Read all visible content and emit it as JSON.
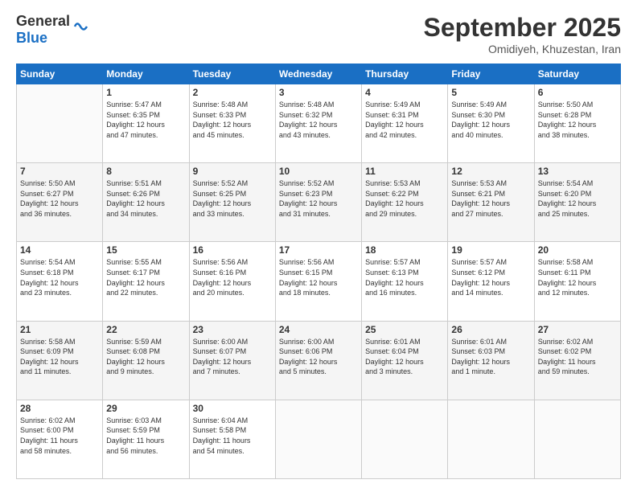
{
  "header": {
    "logo_line1": "General",
    "logo_line2": "Blue",
    "month": "September 2025",
    "location": "Omidiyeh, Khuzestan, Iran"
  },
  "days_of_week": [
    "Sunday",
    "Monday",
    "Tuesday",
    "Wednesday",
    "Thursday",
    "Friday",
    "Saturday"
  ],
  "weeks": [
    [
      {
        "day": "",
        "info": ""
      },
      {
        "day": "1",
        "info": "Sunrise: 5:47 AM\nSunset: 6:35 PM\nDaylight: 12 hours\nand 47 minutes."
      },
      {
        "day": "2",
        "info": "Sunrise: 5:48 AM\nSunset: 6:33 PM\nDaylight: 12 hours\nand 45 minutes."
      },
      {
        "day": "3",
        "info": "Sunrise: 5:48 AM\nSunset: 6:32 PM\nDaylight: 12 hours\nand 43 minutes."
      },
      {
        "day": "4",
        "info": "Sunrise: 5:49 AM\nSunset: 6:31 PM\nDaylight: 12 hours\nand 42 minutes."
      },
      {
        "day": "5",
        "info": "Sunrise: 5:49 AM\nSunset: 6:30 PM\nDaylight: 12 hours\nand 40 minutes."
      },
      {
        "day": "6",
        "info": "Sunrise: 5:50 AM\nSunset: 6:28 PM\nDaylight: 12 hours\nand 38 minutes."
      }
    ],
    [
      {
        "day": "7",
        "info": "Sunrise: 5:50 AM\nSunset: 6:27 PM\nDaylight: 12 hours\nand 36 minutes."
      },
      {
        "day": "8",
        "info": "Sunrise: 5:51 AM\nSunset: 6:26 PM\nDaylight: 12 hours\nand 34 minutes."
      },
      {
        "day": "9",
        "info": "Sunrise: 5:52 AM\nSunset: 6:25 PM\nDaylight: 12 hours\nand 33 minutes."
      },
      {
        "day": "10",
        "info": "Sunrise: 5:52 AM\nSunset: 6:23 PM\nDaylight: 12 hours\nand 31 minutes."
      },
      {
        "day": "11",
        "info": "Sunrise: 5:53 AM\nSunset: 6:22 PM\nDaylight: 12 hours\nand 29 minutes."
      },
      {
        "day": "12",
        "info": "Sunrise: 5:53 AM\nSunset: 6:21 PM\nDaylight: 12 hours\nand 27 minutes."
      },
      {
        "day": "13",
        "info": "Sunrise: 5:54 AM\nSunset: 6:20 PM\nDaylight: 12 hours\nand 25 minutes."
      }
    ],
    [
      {
        "day": "14",
        "info": "Sunrise: 5:54 AM\nSunset: 6:18 PM\nDaylight: 12 hours\nand 23 minutes."
      },
      {
        "day": "15",
        "info": "Sunrise: 5:55 AM\nSunset: 6:17 PM\nDaylight: 12 hours\nand 22 minutes."
      },
      {
        "day": "16",
        "info": "Sunrise: 5:56 AM\nSunset: 6:16 PM\nDaylight: 12 hours\nand 20 minutes."
      },
      {
        "day": "17",
        "info": "Sunrise: 5:56 AM\nSunset: 6:15 PM\nDaylight: 12 hours\nand 18 minutes."
      },
      {
        "day": "18",
        "info": "Sunrise: 5:57 AM\nSunset: 6:13 PM\nDaylight: 12 hours\nand 16 minutes."
      },
      {
        "day": "19",
        "info": "Sunrise: 5:57 AM\nSunset: 6:12 PM\nDaylight: 12 hours\nand 14 minutes."
      },
      {
        "day": "20",
        "info": "Sunrise: 5:58 AM\nSunset: 6:11 PM\nDaylight: 12 hours\nand 12 minutes."
      }
    ],
    [
      {
        "day": "21",
        "info": "Sunrise: 5:58 AM\nSunset: 6:09 PM\nDaylight: 12 hours\nand 11 minutes."
      },
      {
        "day": "22",
        "info": "Sunrise: 5:59 AM\nSunset: 6:08 PM\nDaylight: 12 hours\nand 9 minutes."
      },
      {
        "day": "23",
        "info": "Sunrise: 6:00 AM\nSunset: 6:07 PM\nDaylight: 12 hours\nand 7 minutes."
      },
      {
        "day": "24",
        "info": "Sunrise: 6:00 AM\nSunset: 6:06 PM\nDaylight: 12 hours\nand 5 minutes."
      },
      {
        "day": "25",
        "info": "Sunrise: 6:01 AM\nSunset: 6:04 PM\nDaylight: 12 hours\nand 3 minutes."
      },
      {
        "day": "26",
        "info": "Sunrise: 6:01 AM\nSunset: 6:03 PM\nDaylight: 12 hours\nand 1 minute."
      },
      {
        "day": "27",
        "info": "Sunrise: 6:02 AM\nSunset: 6:02 PM\nDaylight: 11 hours\nand 59 minutes."
      }
    ],
    [
      {
        "day": "28",
        "info": "Sunrise: 6:02 AM\nSunset: 6:00 PM\nDaylight: 11 hours\nand 58 minutes."
      },
      {
        "day": "29",
        "info": "Sunrise: 6:03 AM\nSunset: 5:59 PM\nDaylight: 11 hours\nand 56 minutes."
      },
      {
        "day": "30",
        "info": "Sunrise: 6:04 AM\nSunset: 5:58 PM\nDaylight: 11 hours\nand 54 minutes."
      },
      {
        "day": "",
        "info": ""
      },
      {
        "day": "",
        "info": ""
      },
      {
        "day": "",
        "info": ""
      },
      {
        "day": "",
        "info": ""
      }
    ]
  ]
}
